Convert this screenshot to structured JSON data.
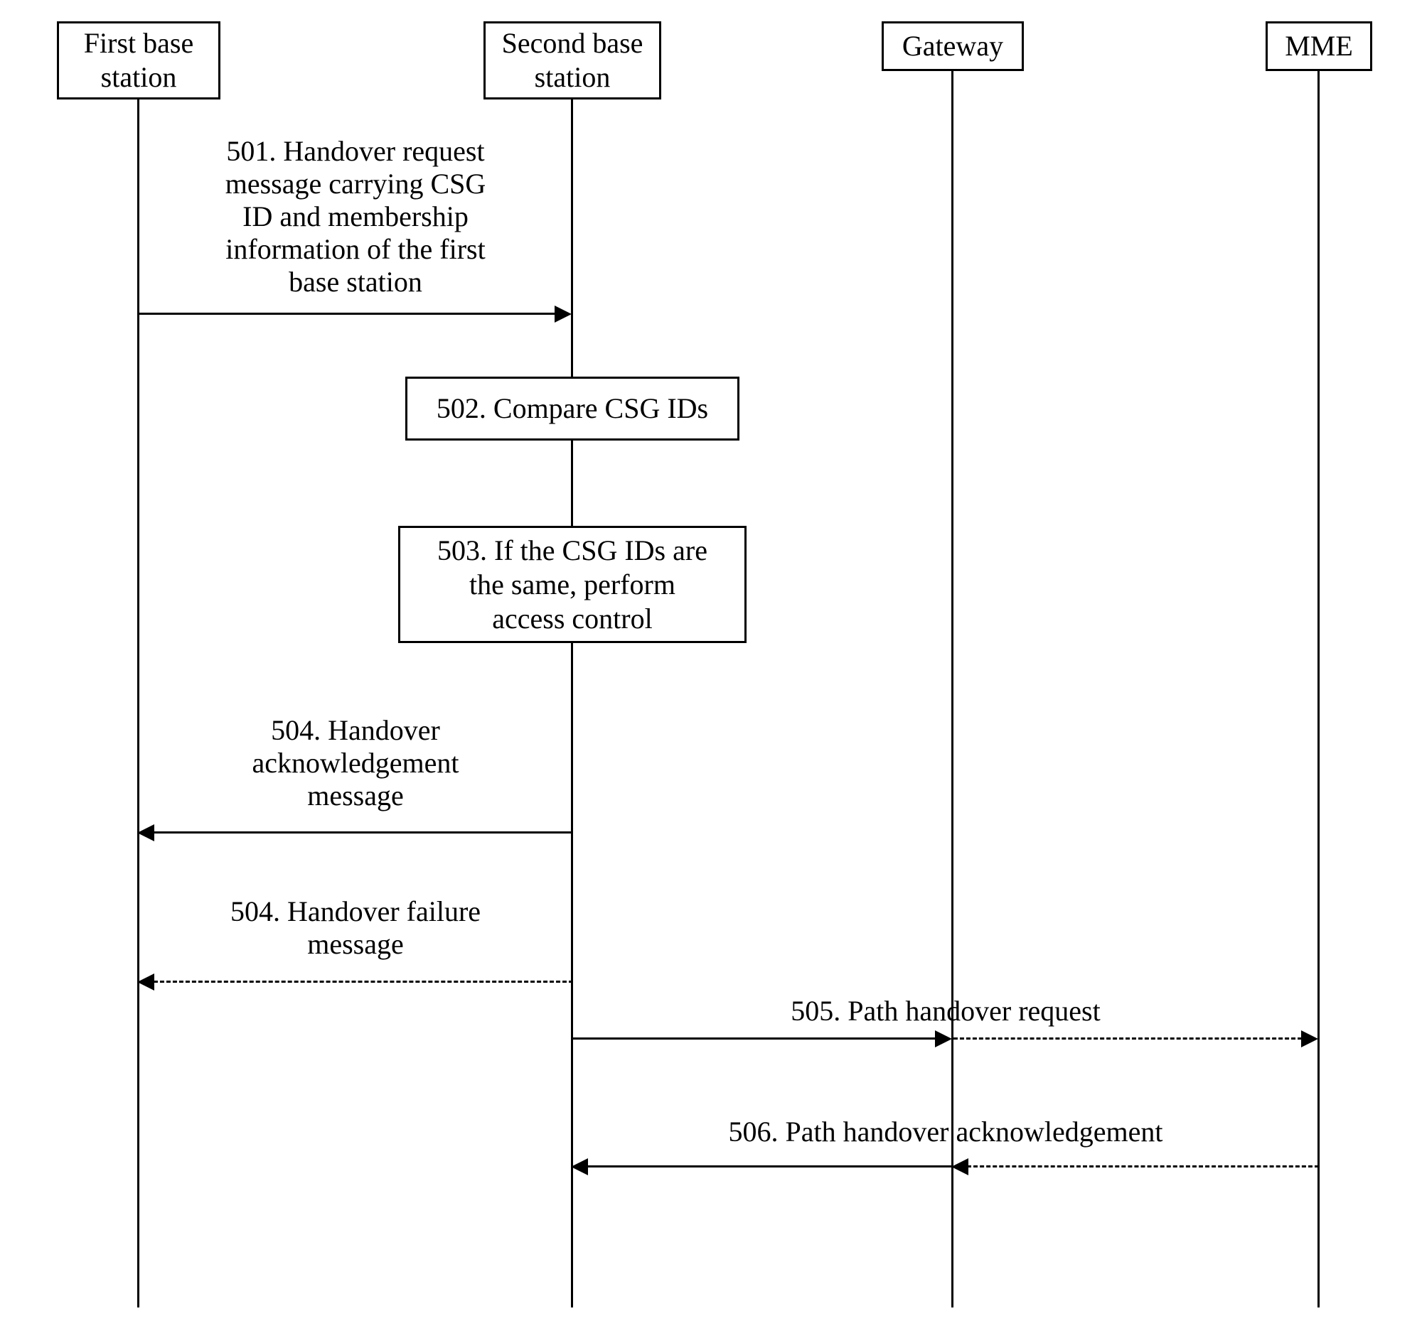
{
  "actors": {
    "first_base_station": "First base\nstation",
    "second_base_station": "Second base\nstation",
    "gateway": "Gateway",
    "mme": "MME"
  },
  "messages": {
    "m501": "501. Handover request\nmessage carrying CSG\nID and membership\ninformation of the first\nbase station",
    "m502": "502. Compare CSG IDs",
    "m503": "503. If the CSG IDs are\nthe same, perform\naccess control",
    "m504a": "504. Handover\nacknowledgement\nmessage",
    "m504b": "504. Handover failure\nmessage",
    "m505": "505. Path handover request",
    "m506": "506. Path handover acknowledgement"
  }
}
